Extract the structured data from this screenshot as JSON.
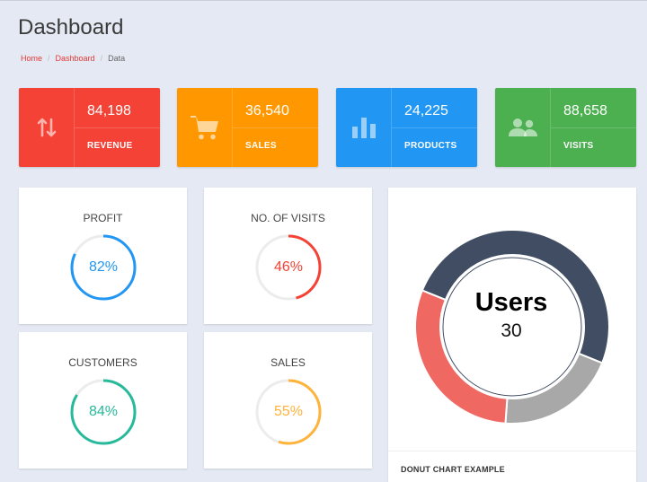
{
  "header": {
    "title": "Dashboard",
    "breadcrumb": [
      {
        "label": "Home"
      },
      {
        "label": "Dashboard"
      },
      {
        "label": "Data"
      }
    ]
  },
  "stats": [
    {
      "value": "84,198",
      "label": "REVENUE",
      "color": "#f44336",
      "icon": "arrows-swap-icon"
    },
    {
      "value": "36,540",
      "label": "SALES",
      "color": "#ff9800",
      "icon": "shopping-cart-icon"
    },
    {
      "value": "24,225",
      "label": "PRODUCTS",
      "color": "#2196f3",
      "icon": "bar-chart-icon"
    },
    {
      "value": "88,658",
      "label": "VISITS",
      "color": "#4caf50",
      "icon": "users-icon"
    }
  ],
  "gauges": [
    {
      "title": "PROFIT",
      "value": "82%",
      "percent": 82,
      "color": "#2196f3"
    },
    {
      "title": "NO. OF VISITS",
      "value": "46%",
      "percent": 46,
      "color": "#f44336"
    },
    {
      "title": "CUSTOMERS",
      "value": "84%",
      "percent": 84,
      "color": "#26b99a"
    },
    {
      "title": "SALES",
      "value": "55%",
      "percent": 55,
      "color": "#ffb33a"
    }
  ],
  "donut": {
    "center_title": "Users",
    "center_value": "30",
    "caption": "DONUT CHART EXAMPLE",
    "segments": [
      {
        "value": 50,
        "color": "#414d62"
      },
      {
        "value": 20,
        "color": "#a8a8a8"
      },
      {
        "value": 30,
        "color": "#ef6962"
      }
    ]
  }
}
